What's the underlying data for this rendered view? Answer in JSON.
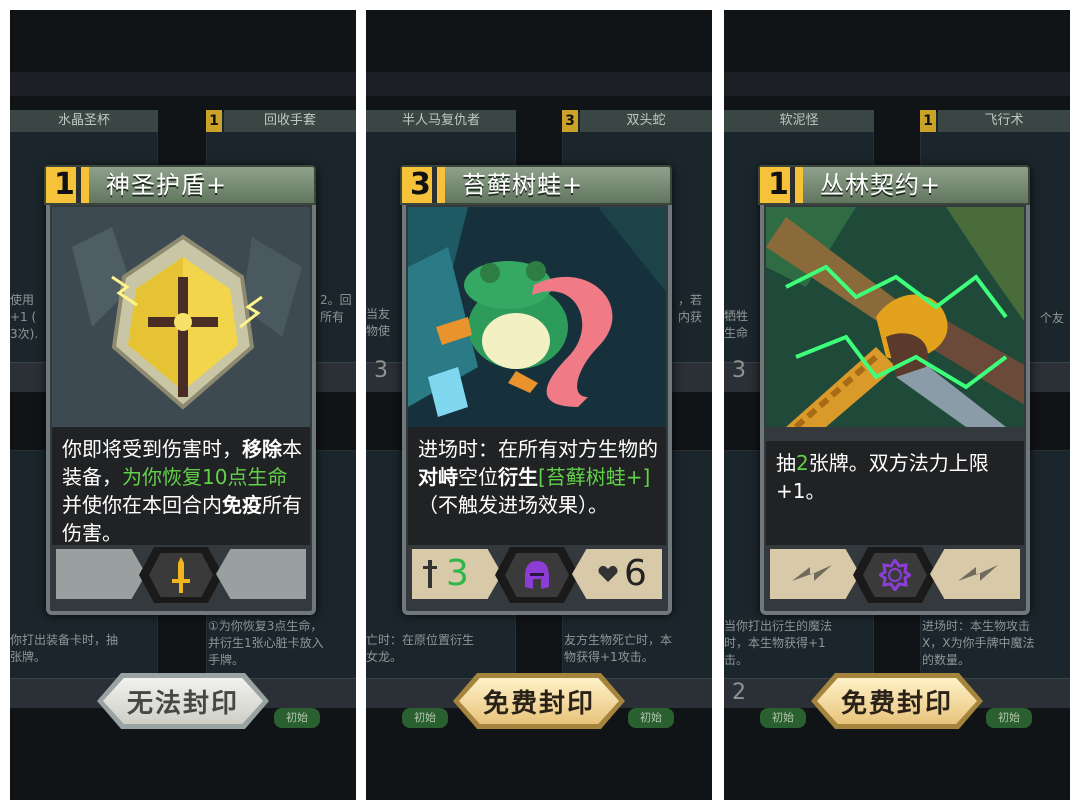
{
  "panels": [
    {
      "ghost_cards": {
        "top_left_title": "水晶圣杯",
        "top_right_cost": "1",
        "top_right_title": "回收手套",
        "top_left_text": "使用\n+1 (\n3次).",
        "top_right_text": "2。回\n所有",
        "bottom_left_text": "你打出装备卡时，抽\n张牌。",
        "bottom_right_text": "①为你恢复3点生命，\n并衍生1张心脏卡放入\n手牌。",
        "bottom_tag": "初始"
      },
      "card": {
        "cost": "1",
        "title": "神圣护盾+",
        "description": [
          {
            "text": "你即将受到伤害时，",
            "style": ""
          },
          {
            "text": "移除",
            "style": "b"
          },
          {
            "text": "本装备，",
            "style": ""
          },
          {
            "text": "为你恢复10点生命",
            "style": "g"
          },
          {
            "text": "并使你在本回合内",
            "style": ""
          },
          {
            "text": "免疫",
            "style": "b"
          },
          {
            "text": "所有伤害。",
            "style": ""
          }
        ],
        "center_icon": "dagger-icon"
      },
      "seal_button": "无法封印"
    },
    {
      "ghost_cards": {
        "top_left_title": "半人马复仇者",
        "top_right_cost": "3",
        "top_right_title": "双头蛇",
        "top_left_text": "当友\n物使",
        "top_right_text": "，若\n内获",
        "bottom_left_text": "亡时：在原位置衍生\n女龙。",
        "bottom_right_text": "友方生物死亡时，本\n物获得+1攻击。",
        "left_num": "3",
        "bottom_tag": "初始"
      },
      "card": {
        "cost": "3",
        "title": "苔藓树蛙+",
        "description": [
          {
            "text": "进场时：在所有对方生物的",
            "style": ""
          },
          {
            "text": "对峙",
            "style": "b"
          },
          {
            "text": "空位",
            "style": ""
          },
          {
            "text": "衍生",
            "style": "b"
          },
          {
            "text": "[苔藓树蛙+]",
            "style": "g"
          },
          {
            "text": "（不触发进场效果）。",
            "style": ""
          }
        ],
        "center_icon": "helmet-icon",
        "attack": "3",
        "health": "6"
      },
      "seal_button": "免费封印"
    },
    {
      "ghost_cards": {
        "top_left_title": "软泥怪",
        "top_right_cost": "1",
        "top_right_title": "飞行术",
        "top_left_text": "牺牲\n生命",
        "top_right_text": "个友",
        "bottom_left_text": "当你打出衍生的魔法\n时，本生物获得+1\n击。",
        "bottom_right_text": "进场时：本生物攻击\nX，X为你手牌中魔法\n的数量。",
        "left_num": "3",
        "bottom_left_num": "2",
        "bottom_tag": "初始"
      },
      "card": {
        "cost": "1",
        "title": "丛林契约+",
        "description": [
          {
            "text": "抽",
            "style": ""
          },
          {
            "text": "2",
            "style": "g"
          },
          {
            "text": "张牌。双方法力上限+1。",
            "style": ""
          }
        ],
        "center_icon": "star-seal-icon"
      },
      "seal_button": "免费封印"
    }
  ],
  "colors": {
    "cost_gold": "#f5c23a",
    "highlight_green": "#62d14a",
    "attack_green": "#2fb54a",
    "helmet_purple": "#8b3dd6",
    "dagger_gold": "#f2b41f"
  }
}
